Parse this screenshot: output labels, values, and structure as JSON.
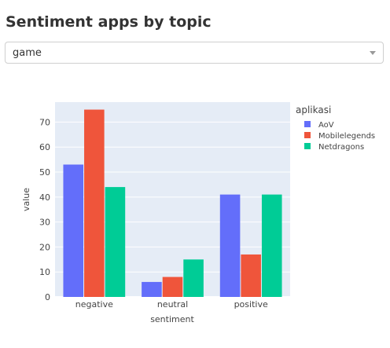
{
  "page": {
    "title": "Sentiment apps by topic"
  },
  "dropdown": {
    "selected": "game"
  },
  "colors": {
    "plot_bg": "#e5ecf6",
    "grid": "#ffffff",
    "AoV": "#636efa",
    "Mobilelegends": "#ef553b",
    "Netdragons": "#00cc96"
  },
  "icons": {
    "dropdown": "chevron-down-icon"
  },
  "chart_data": {
    "type": "bar",
    "title": "",
    "xlabel": "sentiment",
    "ylabel": "value",
    "ylim": [
      0,
      78
    ],
    "yticks": [
      0,
      10,
      20,
      30,
      40,
      50,
      60,
      70
    ],
    "categories": [
      "negative",
      "neutral",
      "positive"
    ],
    "legend_title": "aplikasi",
    "legend_position": "right",
    "grid": true,
    "series": [
      {
        "name": "AoV",
        "color": "#636efa",
        "values": [
          53,
          6,
          41
        ]
      },
      {
        "name": "Mobilelegends",
        "color": "#ef553b",
        "values": [
          75,
          8,
          17
        ]
      },
      {
        "name": "Netdragons",
        "color": "#00cc96",
        "values": [
          44,
          15,
          41
        ]
      }
    ]
  }
}
